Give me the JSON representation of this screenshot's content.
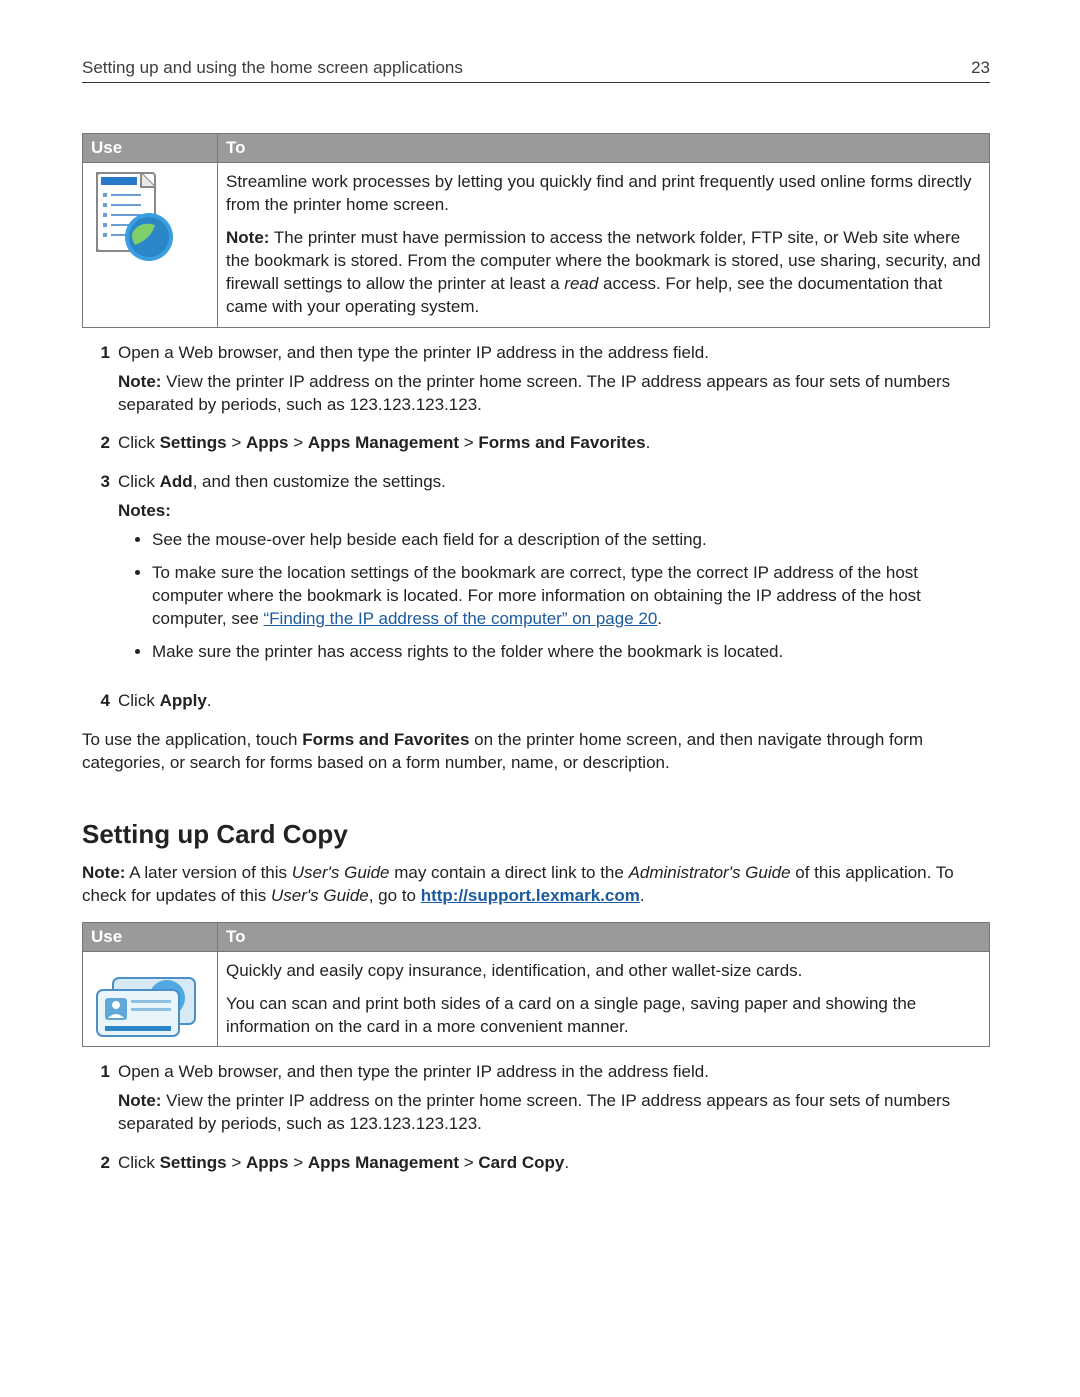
{
  "header": {
    "title": "Setting up and using the home screen applications",
    "page": "23"
  },
  "table1": {
    "headers": [
      "Use",
      "To"
    ],
    "row": {
      "p1": "Streamline work processes by letting you quickly find and print frequently used online forms directly from the printer home screen.",
      "note_label": "Note:",
      "note_text": " The printer must have permission to access the network folder, FTP site, or Web site where the bookmark is stored. From the computer where the bookmark is stored, use sharing, security, and firewall settings to allow the printer at least a ",
      "note_ital": "read",
      "note_after": " access. For help, see the documentation that came with your operating system."
    }
  },
  "steps1": {
    "s1": {
      "num": "1",
      "text": "Open a Web browser, and then type the printer IP address in the address field.",
      "sub_bold": "Note:",
      "sub_rest": " View the printer IP address on the printer home screen. The IP address appears as four sets of numbers separated by periods, such as 123.123.123.123."
    },
    "s2": {
      "num": "2",
      "pre": "Click ",
      "b1": "Settings",
      "sep": " > ",
      "b2": "Apps",
      "b3": "Apps Management",
      "b4": "Forms and Favorites",
      "end": "."
    },
    "s3": {
      "num": "3",
      "pre": "Click ",
      "b1": "Add",
      "rest": ", and then customize the settings.",
      "notes_label": "Notes:",
      "bul1": "See the mouse-over help beside each field for a description of the setting.",
      "bul2_a": "To make sure the location settings of the bookmark are correct, type the correct IP address of the host computer where the bookmark is located. For more information on obtaining the IP address of the host computer, see ",
      "bul2_link": "“Finding the IP address of the computer” on page 20",
      "bul2_b": ".",
      "bul3": "Make sure the printer has access rights to the folder where the bookmark is located."
    },
    "s4": {
      "num": "4",
      "pre": "Click ",
      "b1": "Apply",
      "end": "."
    }
  },
  "closing1_a": "To use the application, touch ",
  "closing1_b": "Forms and Favorites",
  "closing1_c": " on the printer home screen, and then navigate through form categories, or search for forms based on a form number, name, or description.",
  "h2": "Setting up Card Copy",
  "intro2_a": "Note:",
  "intro2_b": " A later version of this ",
  "intro2_c": "User's Guide",
  "intro2_d": " may contain a direct link to the ",
  "intro2_e": "Administrator's Guide",
  "intro2_f": " of this application. To check for updates of this ",
  "intro2_g": "User's Guide",
  "intro2_h": ", go to ",
  "intro2_link": "http://support.lexmark.com",
  "intro2_i": ".",
  "table2": {
    "headers": [
      "Use",
      "To"
    ],
    "row": {
      "p1": "Quickly and easily copy insurance, identification, and other wallet-size cards.",
      "p2": "You can scan and print both sides of a card on a single page, saving paper and showing the information on the card in a more convenient manner."
    }
  },
  "steps2": {
    "s1": {
      "num": "1",
      "text": "Open a Web browser, and then type the printer IP address in the address field.",
      "sub_bold": "Note:",
      "sub_rest": " View the printer IP address on the printer home screen. The IP address appears as four sets of numbers separated by periods, such as 123.123.123.123."
    },
    "s2": {
      "num": "2",
      "pre": "Click ",
      "b1": "Settings",
      "sep": " > ",
      "b2": "Apps",
      "b3": "Apps Management",
      "b4": "Card Copy",
      "end": "."
    }
  }
}
